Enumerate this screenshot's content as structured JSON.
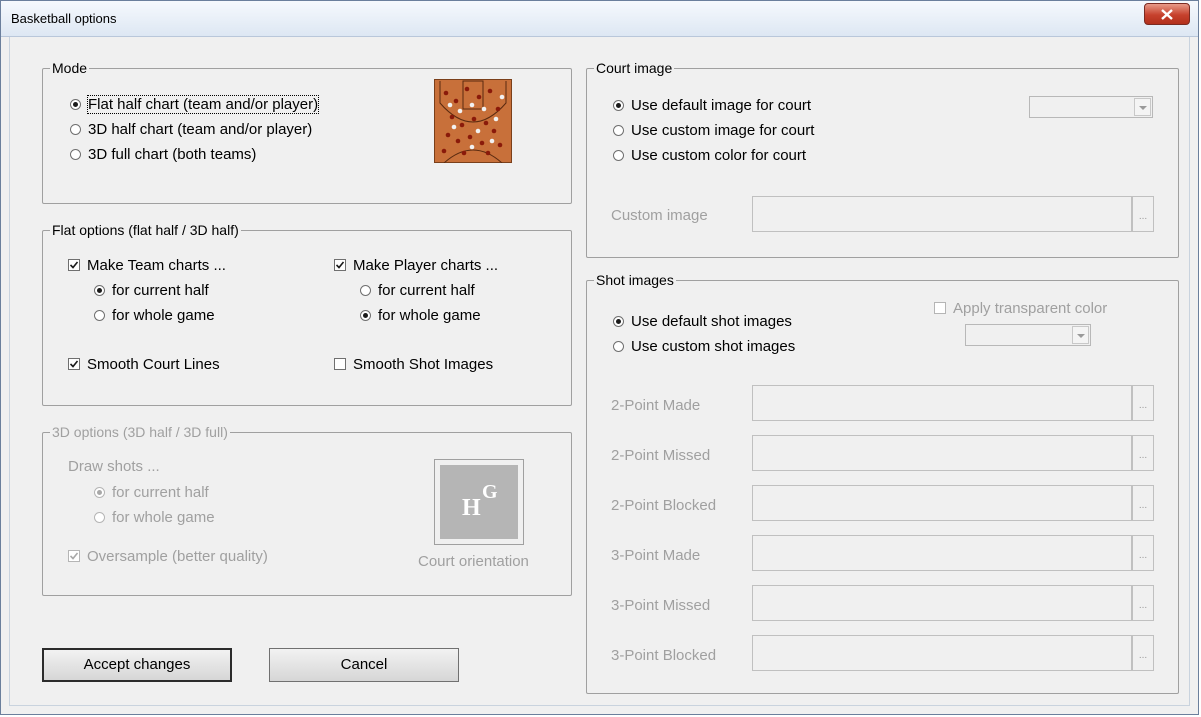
{
  "window": {
    "title": "Basketball options"
  },
  "mode": {
    "title": "Mode",
    "options": [
      "Flat half chart (team and/or player)",
      "3D half chart (team and/or player)",
      "3D full chart (both teams)"
    ],
    "selected": 0
  },
  "flat": {
    "title": "Flat options (flat half / 3D half)",
    "team_charts": "Make Team charts ...",
    "team_current": "for current half",
    "team_whole": "for whole game",
    "player_charts": "Make Player charts ...",
    "player_current": "for current half",
    "player_whole": "for whole game",
    "smooth_court": "Smooth Court Lines",
    "smooth_shot": "Smooth Shot Images"
  },
  "options3d": {
    "title": "3D options (3D half / 3D full)",
    "draw_shots": "Draw shots ...",
    "current": "for current half",
    "whole": "for whole game",
    "oversample": "Oversample (better quality)",
    "orientation": "Court orientation",
    "orientation_h": "H",
    "orientation_g": "G"
  },
  "court": {
    "title": "Court image",
    "default": "Use default image for court",
    "custom_image": "Use custom image for court",
    "custom_color": "Use custom color for court",
    "custom_image_label": "Custom image",
    "browse": "..."
  },
  "shots": {
    "title": "Shot images",
    "default": "Use default shot images",
    "custom": "Use custom shot images",
    "transparent": "Apply transparent color",
    "fields": [
      "2-Point Made",
      "2-Point Missed",
      "2-Point Blocked",
      "3-Point Made",
      "3-Point Missed",
      "3-Point Blocked"
    ],
    "browse": "..."
  },
  "buttons": {
    "accept": "Accept changes",
    "cancel": "Cancel"
  },
  "icons": {
    "close": "close-icon",
    "court_thumbnail": "basketball-court-icon",
    "orientation": "court-orientation-icon"
  },
  "colors": {
    "court": "#c8703a",
    "accent_close": "#c6412d"
  }
}
